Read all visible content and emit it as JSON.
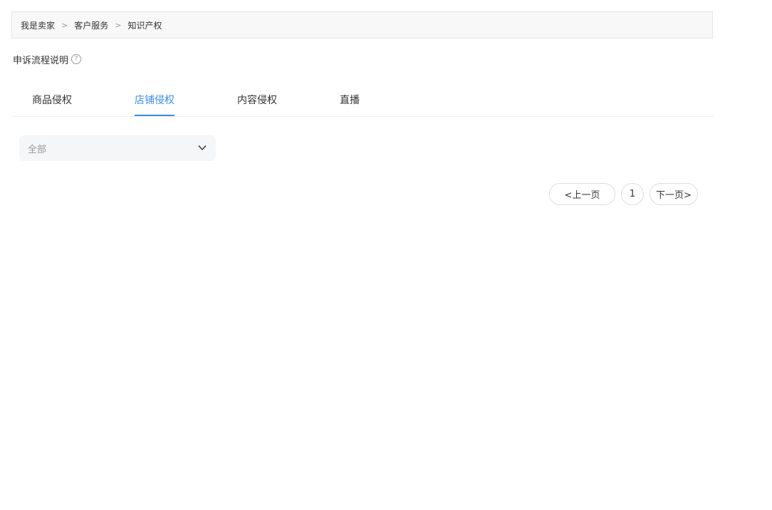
{
  "breadcrumb": {
    "items": [
      "我是卖家",
      "客户服务",
      "知识产权"
    ],
    "separator": ">"
  },
  "help": {
    "label": "申诉流程说明",
    "icon": "question-circle-icon"
  },
  "tabs": [
    {
      "label": "商品侵权",
      "active": false
    },
    {
      "label": "店铺侵权",
      "active": true
    },
    {
      "label": "内容侵权",
      "active": false
    },
    {
      "label": "直播",
      "active": false
    }
  ],
  "filter": {
    "selected": "全部",
    "icon": "chevron-down-icon"
  },
  "pagination": {
    "prev_label": "<上一页",
    "current_page": "1",
    "next_label": "下一页>"
  },
  "colors": {
    "accent": "#3a8ee6",
    "breadcrumb_bg": "#f8f8f8",
    "select_bg": "#f5f6f8"
  }
}
